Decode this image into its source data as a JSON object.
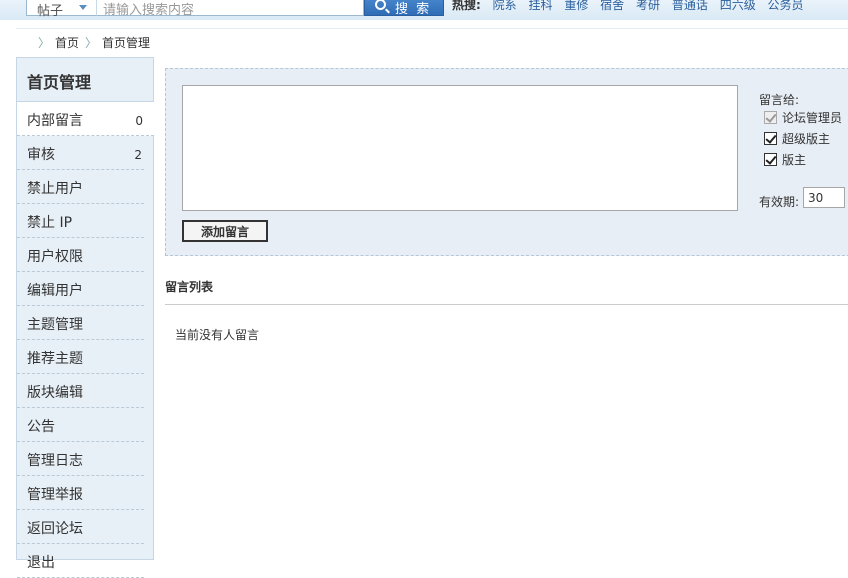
{
  "search": {
    "type_label": "帖子",
    "placeholder": "请输入搜索内容",
    "button_label": "搜 索",
    "hot_label": "热搜:",
    "hot_links": [
      "院系",
      "挂科",
      "重修",
      "宿舍",
      "考研",
      "普通话",
      "四六级",
      "公务员"
    ]
  },
  "breadcrumb": [
    "首页",
    "首页管理"
  ],
  "sidebar": {
    "title": "首页管理",
    "items": [
      {
        "label": "内部留言",
        "count": "0"
      },
      {
        "label": "审核",
        "count": "2"
      },
      {
        "label": "禁止用户",
        "count": ""
      },
      {
        "label": "禁止 IP",
        "count": ""
      },
      {
        "label": "用户权限",
        "count": ""
      },
      {
        "label": "编辑用户",
        "count": ""
      },
      {
        "label": "主题管理",
        "count": ""
      },
      {
        "label": "推荐主题",
        "count": ""
      },
      {
        "label": "版块编辑",
        "count": ""
      },
      {
        "label": "公告",
        "count": ""
      },
      {
        "label": "管理日志",
        "count": ""
      },
      {
        "label": "管理举报",
        "count": ""
      },
      {
        "label": "返回论坛",
        "count": ""
      },
      {
        "label": "退出",
        "count": ""
      }
    ]
  },
  "compose": {
    "message_value": "",
    "add_button": "添加留言",
    "to_label": "留言给:",
    "recipients": [
      {
        "label": "论坛管理员",
        "checked": true,
        "disabled": true
      },
      {
        "label": "超级版主",
        "checked": true,
        "disabled": false
      },
      {
        "label": "版主",
        "checked": true,
        "disabled": false
      }
    ],
    "valid_label": "有效期:",
    "valid_value": "30"
  },
  "list": {
    "title": "留言列表",
    "empty_message": "当前没有人留言"
  }
}
